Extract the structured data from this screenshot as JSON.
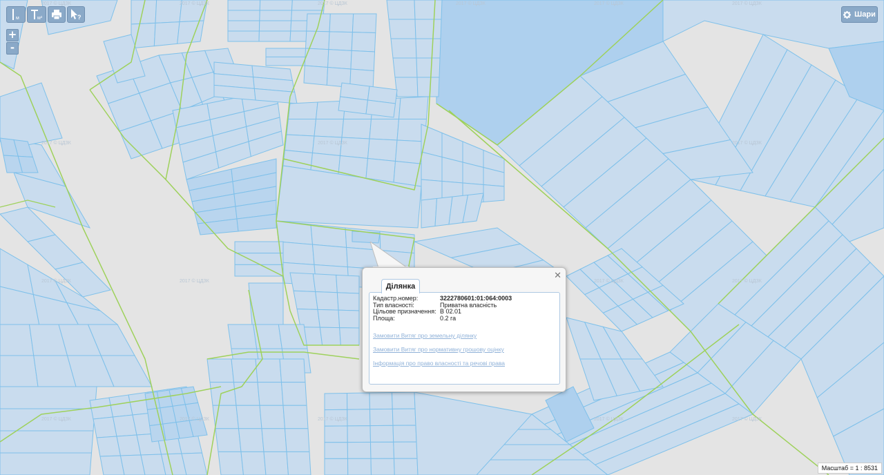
{
  "toolbar": {
    "measure_line_label": "м",
    "measure_area_label": "м²",
    "layers_label": "Шари",
    "zoom_in_label": "+",
    "zoom_out_label": "-"
  },
  "watermark": "2017 © ЦДЗК",
  "popup": {
    "tab_label": "Ділянка",
    "close_label": "✕",
    "fields": [
      {
        "label": "Кадастр.номер:",
        "value": "3222780601:01:064:0003"
      },
      {
        "label": "Тип власності:",
        "value": "Приватна власність"
      },
      {
        "label": "Цільове призначення:",
        "value": "В 02.01"
      },
      {
        "label": "Площа:",
        "value": "0.2 га"
      }
    ],
    "links": [
      "Замовити Витяг про земельну ділянку",
      "Замовити Витяг про нормативну грошову оцінку",
      "Інформація про право власності та речові права"
    ]
  },
  "scale_text": "Масштаб = 1 : 8531",
  "colors": {
    "parcel_fill": "#c9dcee",
    "parcel_stroke": "#7ec0ea",
    "boundary": "#9ed15b",
    "road": "#e4e4e4",
    "button": "#8aa9c8",
    "link": "#8fb1d8"
  }
}
